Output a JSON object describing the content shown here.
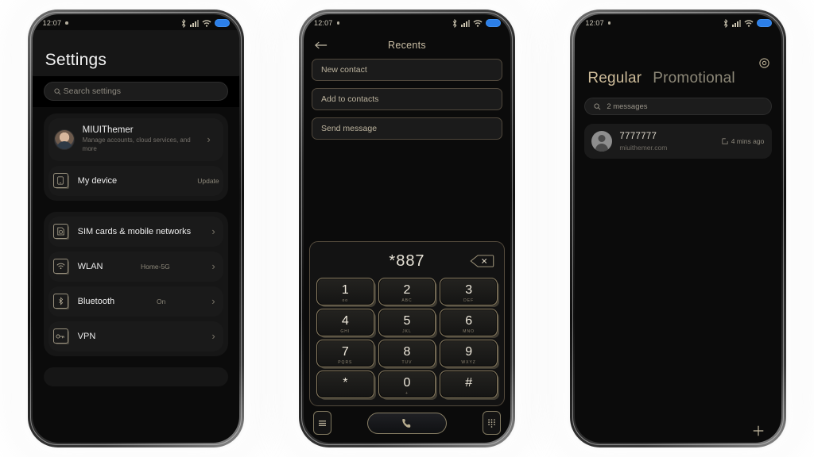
{
  "statusbar": {
    "time": "12:07",
    "icons": [
      "bluetooth-icon",
      "signal-icon",
      "wifi-icon",
      "battery-icon"
    ]
  },
  "settings_phone": {
    "title": "Settings",
    "search": {
      "placeholder": "Search settings",
      "icon": "search-icon"
    },
    "account": {
      "name": "MIUIThemer",
      "subtitle": "Manage accounts, cloud services, and more",
      "avatar": "user-avatar"
    },
    "device": {
      "label": "My device",
      "value": "Update",
      "icon": "phone-icon"
    },
    "items": [
      {
        "label": "SIM cards & mobile networks",
        "value": "",
        "icon": "sim-card-icon"
      },
      {
        "label": "WLAN",
        "value": "Home-5G",
        "icon": "wifi-icon"
      },
      {
        "label": "Bluetooth",
        "value": "On",
        "icon": "bluetooth-icon"
      },
      {
        "label": "VPN",
        "value": "",
        "icon": "key-icon"
      }
    ]
  },
  "dialer_phone": {
    "title": "Recents",
    "back_icon": "back-arrow-icon",
    "options": [
      "New contact",
      "Add to contacts",
      "Send message"
    ],
    "display": "*887",
    "delete_icon": "backspace-icon",
    "keys": [
      {
        "digit": "1",
        "letters": "oo"
      },
      {
        "digit": "2",
        "letters": "ABC"
      },
      {
        "digit": "3",
        "letters": "DEF"
      },
      {
        "digit": "4",
        "letters": "GHI"
      },
      {
        "digit": "5",
        "letters": "JKL"
      },
      {
        "digit": "6",
        "letters": "MNO"
      },
      {
        "digit": "7",
        "letters": "PQRS"
      },
      {
        "digit": "8",
        "letters": "TUV"
      },
      {
        "digit": "9",
        "letters": "WXYZ"
      },
      {
        "digit": "*",
        "letters": ""
      },
      {
        "digit": "0",
        "letters": "+"
      },
      {
        "digit": "#",
        "letters": ""
      }
    ],
    "bottom": {
      "menu_icon": "menu-icon",
      "call_icon": "call-icon",
      "keypad_icon": "keypad-icon"
    }
  },
  "messages_phone": {
    "settings_icon": "gear-icon",
    "tab_active": "Regular",
    "tab_inactive": "Promotional",
    "search": {
      "text": "2 messages",
      "icon": "search-icon"
    },
    "message": {
      "sender": "7777777",
      "preview": "miuithemer.com",
      "time": "4 mins ago",
      "time_icon": "unread-icon",
      "avatar": "contact-avatar"
    },
    "fab": {
      "icon": "plus-icon"
    }
  },
  "colors": {
    "accent_gold": "#cbbfa6",
    "key_border": "#8c7f63",
    "battery_blue": "#2c7fe8",
    "screen_bg": "#0b0b0b"
  }
}
